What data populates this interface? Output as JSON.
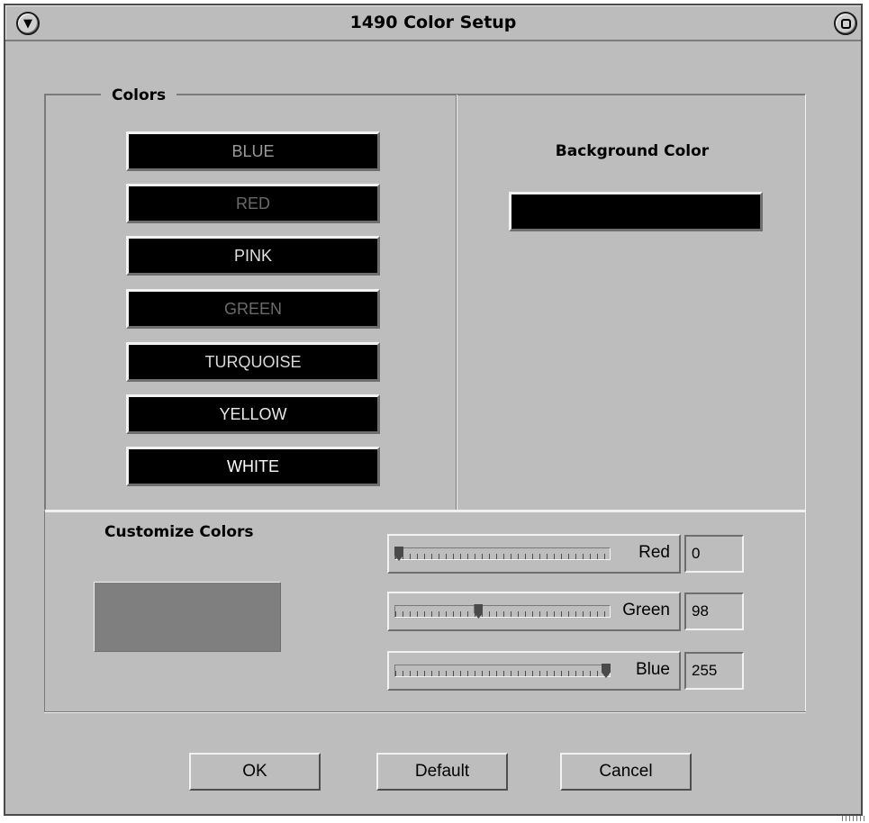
{
  "window": {
    "title": "1490 Color Setup"
  },
  "colors_section": {
    "legend": "Colors",
    "buttons": [
      {
        "label": "BLUE",
        "text_color": "#9a9a9a"
      },
      {
        "label": "RED",
        "text_color": "#6a6a6a"
      },
      {
        "label": "PINK",
        "text_color": "#e0e0e0"
      },
      {
        "label": "GREEN",
        "text_color": "#6a6a6a"
      },
      {
        "label": "TURQUOISE",
        "text_color": "#d8d8d8"
      },
      {
        "label": "YELLOW",
        "text_color": "#e8e8e8"
      },
      {
        "label": "WHITE",
        "text_color": "#ffffff"
      }
    ]
  },
  "background_section": {
    "label": "Background Color",
    "swatch_color": "#000000"
  },
  "customize_section": {
    "label": "Customize Colors",
    "preview_color": "#7f7f7f",
    "sliders": [
      {
        "label": "Red",
        "value": "0",
        "max": 255
      },
      {
        "label": "Green",
        "value": "98",
        "max": 255
      },
      {
        "label": "Blue",
        "value": "255",
        "max": 255
      }
    ]
  },
  "actions": {
    "ok_label": "OK",
    "default_label": "Default",
    "cancel_label": "Cancel"
  },
  "icons": {
    "window_menu": "window-menu-icon",
    "maximize": "maximize-icon"
  }
}
